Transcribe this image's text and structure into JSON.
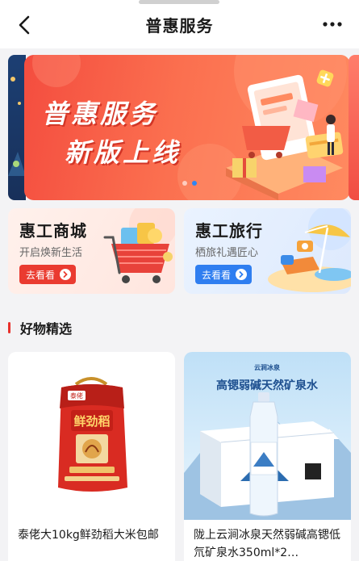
{
  "header": {
    "title": "普惠服务",
    "back_icon": "chevron-left-icon",
    "more_icon": "more-horizontal-icon"
  },
  "banner": {
    "line1": "普惠服务",
    "line2": "新版上线",
    "slide_count": 2,
    "active_slide": 2,
    "accent_color": "#f44d3f"
  },
  "promos": [
    {
      "title": "惠工商城",
      "subtitle": "开启焕新生活",
      "button": "去看看"
    },
    {
      "title": "惠工旅行",
      "subtitle": "栖旅礼遇匠心",
      "button": "去看看"
    }
  ],
  "section": {
    "title": "好物精选"
  },
  "products": [
    {
      "name": "泰佬大10kg鲜劲稻大米包邮",
      "bag_brand": "鲜劲稻",
      "bag_tag": "泰佬"
    },
    {
      "name": "陇上云涧冰泉天然弱碱高锶低氘矿泉水350ml*2…",
      "poster_heading": "高锶弱碱天然矿泉水",
      "brand": "云涧冰泉"
    }
  ],
  "colors": {
    "primary_red": "#ea3b30",
    "primary_blue": "#2f7ef0"
  }
}
